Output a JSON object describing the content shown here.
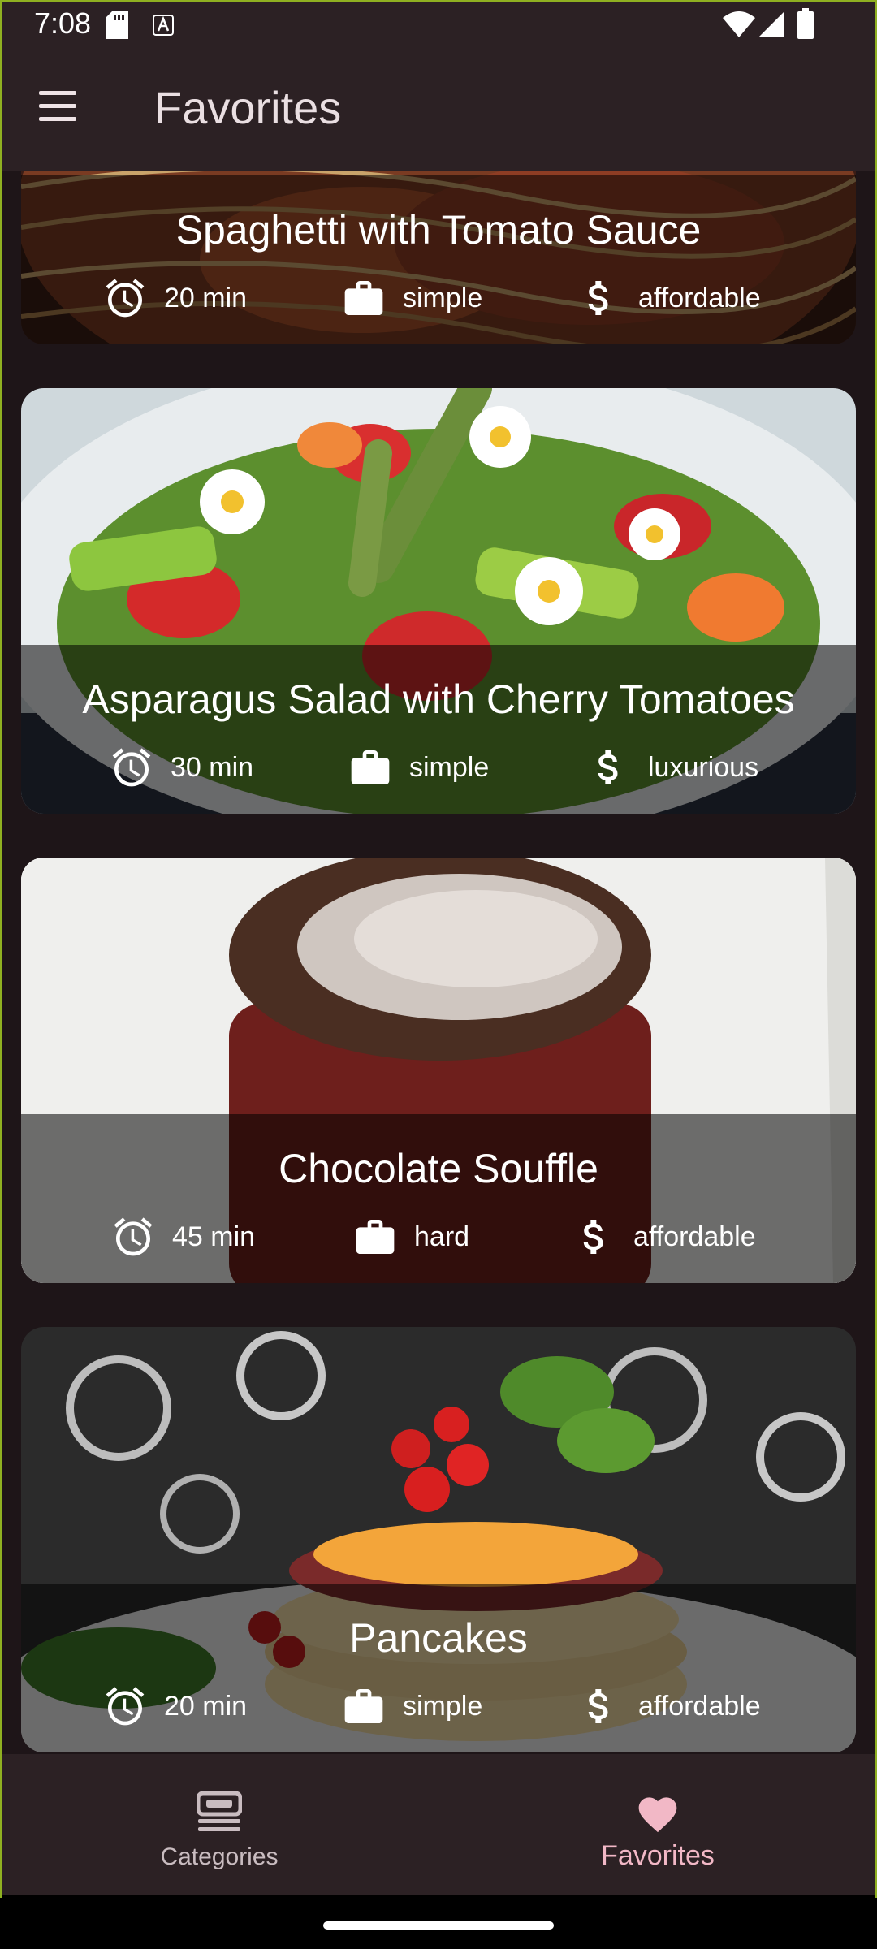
{
  "status": {
    "time": "7:08"
  },
  "appbar": {
    "title": "Favorites"
  },
  "meals": [
    {
      "title": "Spaghetti with Tomato Sauce",
      "duration": "20 min",
      "complexity": "simple",
      "affordability": "affordable"
    },
    {
      "title": "Asparagus Salad with Cherry Tomatoes",
      "duration": "30 min",
      "complexity": "simple",
      "affordability": "luxurious"
    },
    {
      "title": "Chocolate Souffle",
      "duration": "45 min",
      "complexity": "hard",
      "affordability": "affordable"
    },
    {
      "title": "Pancakes",
      "duration": "20 min",
      "complexity": "simple",
      "affordability": "affordable"
    }
  ],
  "bottom_nav": {
    "categories_label": "Categories",
    "favorites_label": "Favorites"
  },
  "colors": {
    "accent": "#f2b8c6",
    "bar": "#2c2124",
    "background": "#1e1518"
  },
  "icons": [
    "menu-icon",
    "alarm-icon",
    "briefcase-icon",
    "dollar-icon",
    "categories-icon",
    "heart-icon",
    "wifi-icon",
    "signal-icon",
    "battery-icon",
    "sd-card-icon",
    "notification-a-icon"
  ]
}
